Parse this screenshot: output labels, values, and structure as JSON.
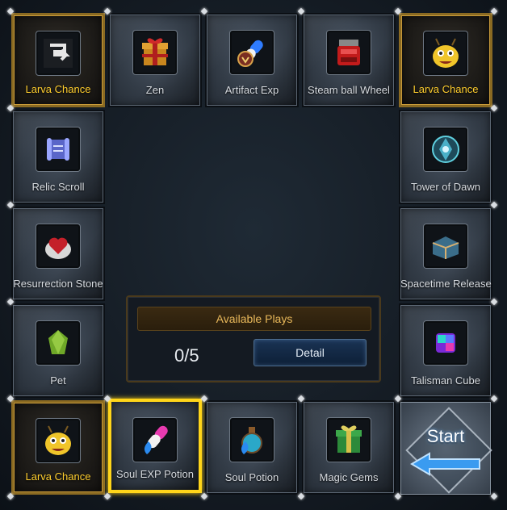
{
  "board": {
    "tiles": [
      {
        "id": "t0",
        "label": "Larva Chance",
        "icon": "larva-icon",
        "style": "gold"
      },
      {
        "id": "t1",
        "label": "Zen",
        "icon": "gift-box-icon",
        "style": "normal"
      },
      {
        "id": "t2",
        "label": "Artifact Exp",
        "icon": "artifact-potion-icon",
        "style": "normal"
      },
      {
        "id": "t3",
        "label": "Steam ball Wheel",
        "icon": "steam-ball-icon",
        "style": "normal"
      },
      {
        "id": "t4",
        "label": "Larva Chance",
        "icon": "larva-icon",
        "style": "gold"
      },
      {
        "id": "t5",
        "label": "Relic Scroll",
        "icon": "scroll-icon",
        "style": "normal"
      },
      {
        "id": "t6",
        "label": "Tower of Dawn",
        "icon": "tower-orb-icon",
        "style": "normal"
      },
      {
        "id": "t7",
        "label": "Resurrection Stone",
        "icon": "heart-stone-icon",
        "style": "normal"
      },
      {
        "id": "t8",
        "label": "Spacetime Release",
        "icon": "spacetime-box-icon",
        "style": "normal"
      },
      {
        "id": "t9",
        "label": "Pet",
        "icon": "green-gem-icon",
        "style": "normal"
      },
      {
        "id": "t10",
        "label": "Talisman Cube",
        "icon": "talisman-cube-icon",
        "style": "normal"
      },
      {
        "id": "t11",
        "label": "Larva Chance",
        "icon": "larva-icon",
        "style": "gold"
      },
      {
        "id": "t12",
        "label": "Soul EXP Potion",
        "icon": "capsule-icon",
        "style": "selected"
      },
      {
        "id": "t13",
        "label": "Soul Potion",
        "icon": "potion-flask-icon",
        "style": "normal"
      },
      {
        "id": "t14",
        "label": "Magic Gems",
        "icon": "green-gift-icon",
        "style": "normal"
      }
    ],
    "back_icon": "return-arrow-icon"
  },
  "panel": {
    "title": "Available Plays",
    "plays_value": "0/5",
    "detail_label": "Detail"
  },
  "start": {
    "label": "Start",
    "arrow_icon": "arrow-left-icon"
  },
  "colors": {
    "gold_border": "#8a6a22",
    "gold_label": "#ffce2e",
    "selected_border": "#ffd51a",
    "panel_title": "#e8b85a",
    "start_arrow": "#3a9bf0"
  }
}
